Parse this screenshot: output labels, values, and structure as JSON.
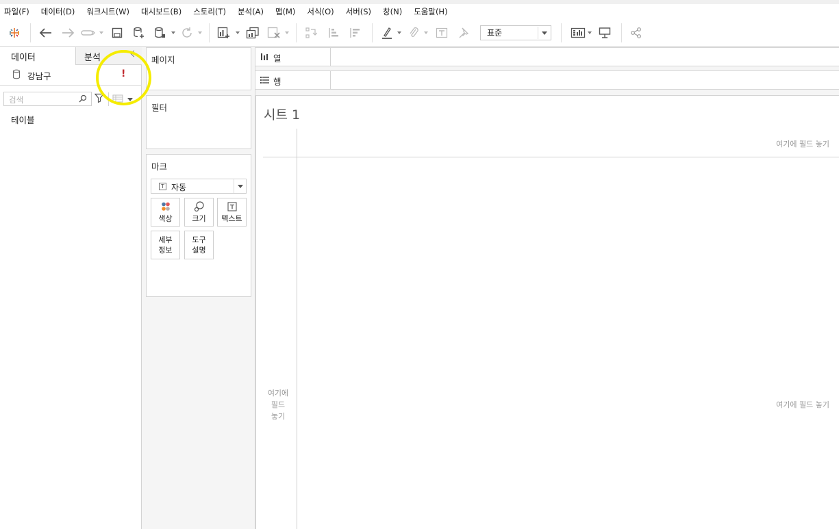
{
  "menu": [
    "파일(F)",
    "데이터(D)",
    "워크시트(W)",
    "대시보드(B)",
    "스토리(T)",
    "분석(A)",
    "맵(M)",
    "서식(O)",
    "서버(S)",
    "창(N)",
    "도움말(H)"
  ],
  "toolbar": {
    "icons": [
      "tableau-logo-icon",
      "back-icon",
      "forward-icon",
      "redo-icon",
      "save-icon",
      "new-datasource-icon",
      "datasource-icon",
      "refresh-icon",
      "new-worksheet-icon",
      "duplicate-icon",
      "clear-sheet-icon",
      "swap-icon",
      "sort-asc-icon",
      "sort-desc-icon",
      "highlight-icon",
      "group-icon",
      "labels-icon",
      "pin-icon",
      "show-me-icon",
      "presentation-icon",
      "share-icon"
    ],
    "fit_value": "표준"
  },
  "data_pane": {
    "tab_data": "데이터",
    "tab_analysis": "분석",
    "source_name": "강남구",
    "warning": "!",
    "search_placeholder": "검색",
    "tables_label": "테이블"
  },
  "cards": {
    "pages": "페이지",
    "filters": "필터",
    "marks": "마크",
    "mark_type": "자동",
    "mark_buttons": {
      "color": "색상",
      "size": "크기",
      "text": "텍스트",
      "detail_1": "세부",
      "detail_2": "정보",
      "tooltip_1": "도구",
      "tooltip_2": "설명"
    }
  },
  "shelves": {
    "columns": "열",
    "rows": "행"
  },
  "sheet": {
    "title": "시트 1",
    "drop_top": "여기에 필드 놓기",
    "drop_left_1": "여기에",
    "drop_left_2": "필드",
    "drop_left_3": "놓기",
    "drop_right": "여기에 필드 놓기"
  },
  "colors": {
    "highlight_ring": "#f5ec00",
    "warning": "#c0282d",
    "pane_bg": "#f5f5f5"
  }
}
